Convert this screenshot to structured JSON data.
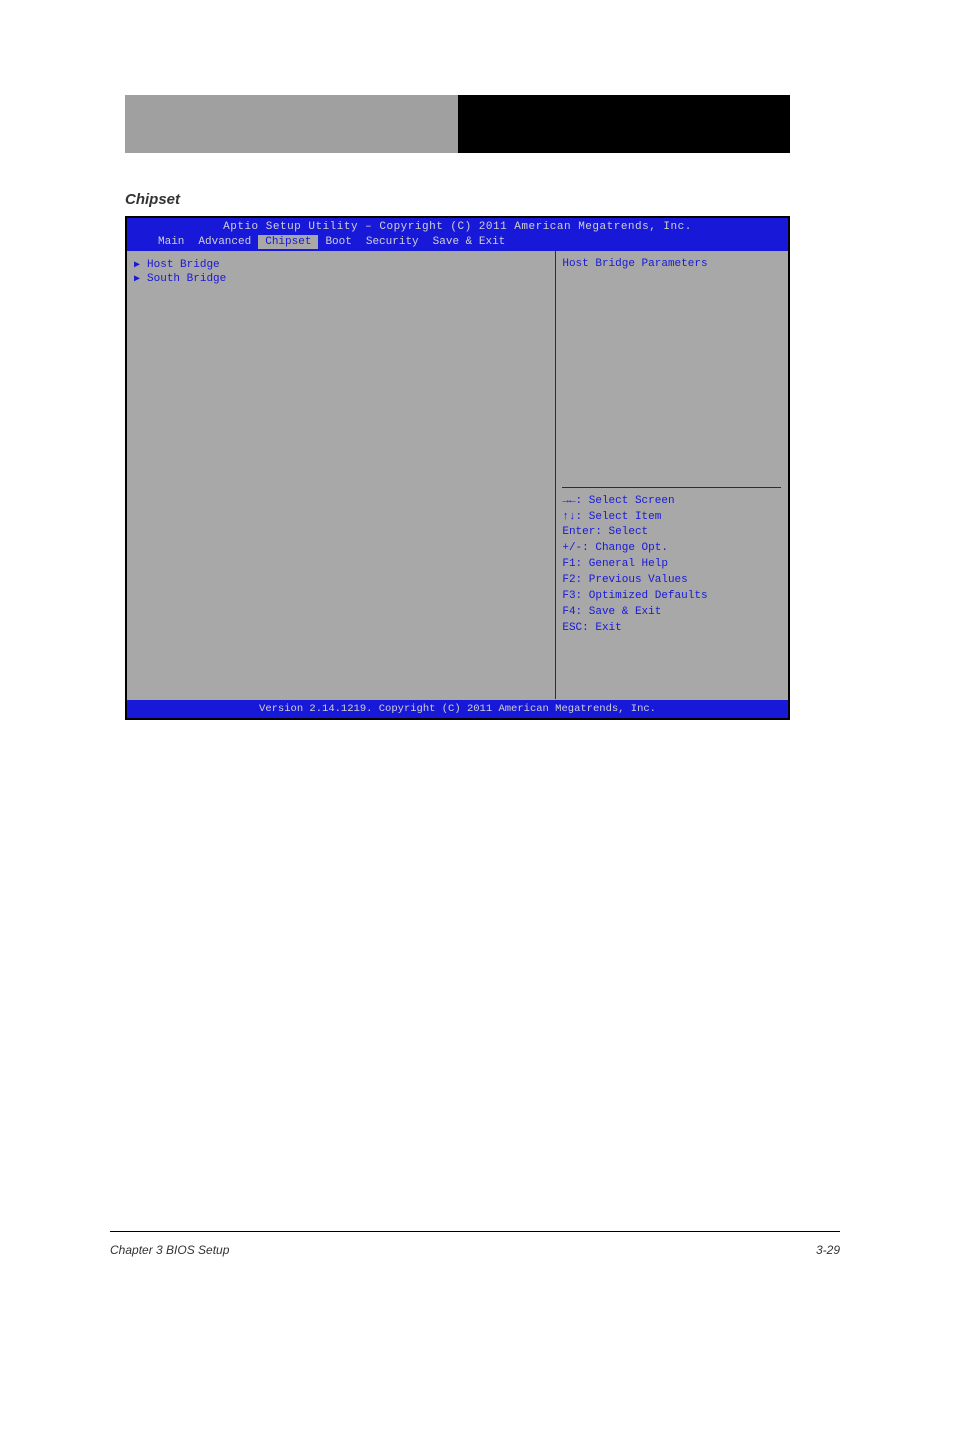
{
  "header": {
    "right_label": ""
  },
  "chipset_heading": "Chipset",
  "bios": {
    "title": "Aptio Setup Utility – Copyright (C) 2011 American Megatrends, Inc.",
    "tabs": [
      "Main",
      "Advanced",
      "Chipset",
      "Boot",
      "Security",
      "Save & Exit"
    ],
    "selected_tab": "Chipset",
    "menu_items": [
      "Host Bridge",
      "South Bridge"
    ],
    "help_description": "Host Bridge Parameters",
    "help_keys": [
      "→←: Select Screen",
      "↑↓: Select Item",
      "Enter: Select",
      "+/-: Change Opt.",
      "F1: General Help",
      "F2: Previous Values",
      "F3: Optimized Defaults",
      "F4: Save & Exit",
      "ESC: Exit"
    ],
    "footer": "Version 2.14.1219. Copyright (C) 2011 American Megatrends, Inc."
  },
  "page_footer": {
    "left": "Chapter 3 BIOS Setup",
    "right": "3-29"
  }
}
